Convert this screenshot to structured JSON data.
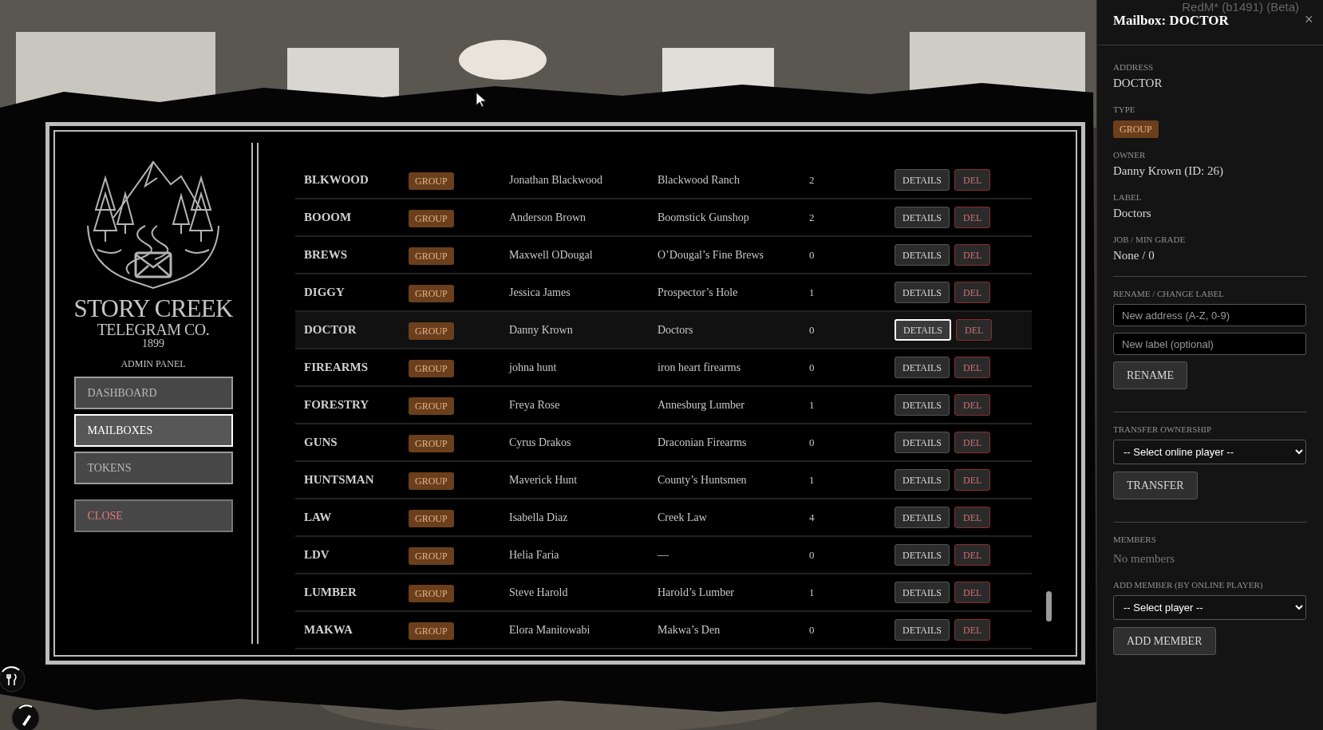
{
  "overlay": {
    "text": "RedM* (b1491) (Beta)"
  },
  "sidebar": {
    "brand": {
      "name": "STORY CREEK",
      "subtitle": "TELEGRAM CO.",
      "year": "1899"
    },
    "caption": "ADMIN PANEL",
    "nav": [
      {
        "label": "DASHBOARD",
        "selected": false
      },
      {
        "label": "MAILBOXES",
        "selected": true
      },
      {
        "label": "TOKENS",
        "selected": false
      }
    ],
    "close": "CLOSE"
  },
  "table": {
    "rows": [
      {
        "address": "BLKWOOD",
        "type": "GROUP",
        "owner": "Jonathan Blackwood",
        "label": "Blackwood Ranch",
        "members": "2",
        "selected": false,
        "actions": [
          "DETAILS",
          "DEL"
        ]
      },
      {
        "address": "BOOOM",
        "type": "GROUP",
        "owner": "Anderson Brown",
        "label": "Boomstick Gunshop",
        "members": "2",
        "selected": false,
        "actions": [
          "DETAILS",
          "DEL"
        ]
      },
      {
        "address": "BREWS",
        "type": "GROUP",
        "owner": "Maxwell ODougal",
        "label": "O’Dougal’s Fine Brews",
        "members": "0",
        "selected": false,
        "actions": [
          "DETAILS",
          "DEL"
        ]
      },
      {
        "address": "DIGGY",
        "type": "GROUP",
        "owner": "Jessica James",
        "label": "Prospector’s Hole",
        "members": "1",
        "selected": false,
        "actions": [
          "DETAILS",
          "DEL"
        ]
      },
      {
        "address": "DOCTOR",
        "type": "GROUP",
        "owner": "Danny Krown",
        "label": "Doctors",
        "members": "0",
        "selected": true,
        "actions": [
          "DETAILS",
          "DEL"
        ]
      },
      {
        "address": "FIREARMS",
        "type": "GROUP",
        "owner": "johna hunt",
        "label": "iron heart firearms",
        "members": "0",
        "selected": false,
        "actions": [
          "DETAILS",
          "DEL"
        ]
      },
      {
        "address": "FORESTRY",
        "type": "GROUP",
        "owner": "Freya Rose",
        "label": "Annesburg Lumber",
        "members": "1",
        "selected": false,
        "actions": [
          "DETAILS",
          "DEL"
        ]
      },
      {
        "address": "GUNS",
        "type": "GROUP",
        "owner": "Cyrus Drakos",
        "label": "Draconian Firearms",
        "members": "0",
        "selected": false,
        "actions": [
          "DETAILS",
          "DEL"
        ]
      },
      {
        "address": "HUNTSMAN",
        "type": "GROUP",
        "owner": "Maverick Hunt",
        "label": "County’s Huntsmen",
        "members": "1",
        "selected": false,
        "actions": [
          "DETAILS",
          "DEL"
        ]
      },
      {
        "address": "LAW",
        "type": "GROUP",
        "owner": "Isabella Diaz",
        "label": "Creek Law",
        "members": "4",
        "selected": false,
        "actions": [
          "DETAILS",
          "DEL"
        ]
      },
      {
        "address": "LDV",
        "type": "GROUP",
        "owner": "Helia Faria",
        "label": "—",
        "members": "0",
        "selected": false,
        "actions": [
          "DETAILS",
          "DEL"
        ]
      },
      {
        "address": "LUMBER",
        "type": "GROUP",
        "owner": "Steve Harold",
        "label": "Harold’s Lumber",
        "members": "1",
        "selected": false,
        "actions": [
          "DETAILS",
          "DEL"
        ]
      },
      {
        "address": "MAKWA",
        "type": "GROUP",
        "owner": "Elora Manitowabi",
        "label": "Makwa’s Den",
        "members": "0",
        "selected": false,
        "actions": [
          "DETAILS",
          "DEL"
        ]
      }
    ]
  },
  "details": {
    "title": "Mailbox: DOCTOR",
    "close": "×",
    "fields": [
      {
        "label": "ADDRESS",
        "value": "DOCTOR",
        "kind": "text"
      },
      {
        "label": "TYPE",
        "value": "GROUP",
        "kind": "badge"
      },
      {
        "label": "OWNER",
        "value": "Danny Krown (ID: 26)",
        "kind": "text"
      },
      {
        "label": "LABEL",
        "value": "Doctors",
        "kind": "text"
      },
      {
        "label": "JOB / MIN GRADE",
        "value": "None / 0",
        "kind": "text"
      }
    ],
    "sections": [
      {
        "items": [
          {
            "kind": "heading",
            "text": "RENAME / CHANGE LABEL"
          },
          {
            "kind": "input",
            "placeholder": "New address (A-Z, 0-9)"
          },
          {
            "kind": "input",
            "placeholder": "New label (optional)"
          },
          {
            "kind": "button",
            "text": "RENAME"
          }
        ]
      },
      {
        "items": [
          {
            "kind": "heading",
            "text": "TRANSFER OWNERSHIP"
          },
          {
            "kind": "select",
            "value": "-- Select online player --"
          },
          {
            "kind": "button",
            "text": "TRANSFER"
          }
        ]
      },
      {
        "items": [
          {
            "kind": "heading",
            "text": "MEMBERS"
          },
          {
            "kind": "empty",
            "text": "No members"
          },
          {
            "kind": "heading",
            "text": "ADD MEMBER (BY ONLINE PLAYER)"
          },
          {
            "kind": "select",
            "value": "-- Select player --"
          },
          {
            "kind": "button",
            "text": "ADD MEMBER"
          }
        ]
      }
    ]
  }
}
